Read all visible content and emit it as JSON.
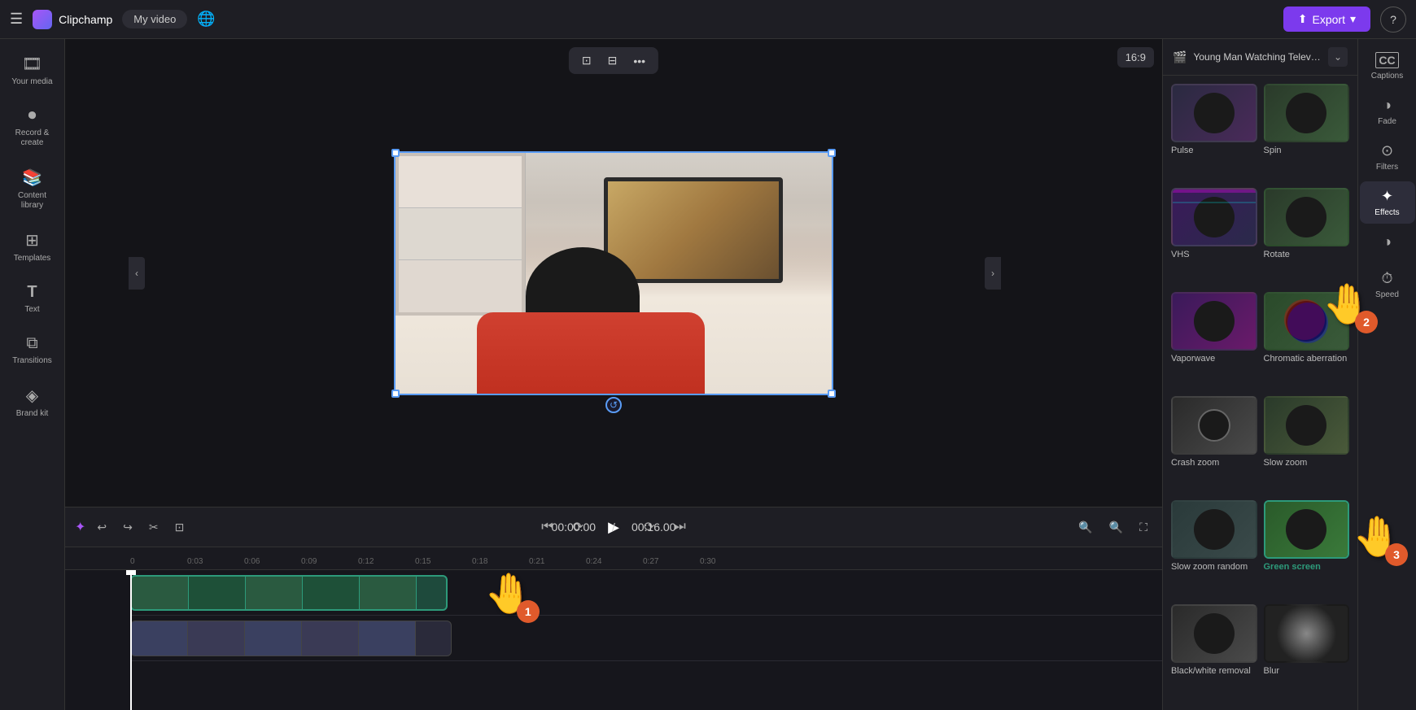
{
  "app": {
    "name": "Clipchamp",
    "video_title": "My video",
    "export_label": "Export",
    "help_label": "?"
  },
  "sidebar": {
    "items": [
      {
        "id": "your-media",
        "icon": "🎞",
        "label": "Your media"
      },
      {
        "id": "record-create",
        "icon": "⏺",
        "label": "Record & create"
      },
      {
        "id": "content-library",
        "icon": "📚",
        "label": "Content library"
      },
      {
        "id": "templates",
        "icon": "⊞",
        "label": "Templates"
      },
      {
        "id": "text",
        "icon": "T",
        "label": "Text"
      },
      {
        "id": "transitions",
        "icon": "⧉",
        "label": "Transitions"
      },
      {
        "id": "brand-kit",
        "icon": "◈",
        "label": "Brand kit"
      }
    ]
  },
  "preview": {
    "aspect_ratio": "16:9",
    "toolbar_items": [
      "crop",
      "fit",
      "more"
    ]
  },
  "timeline": {
    "current_time": "00:00.00",
    "total_time": "00:16.00",
    "ruler_marks": [
      "0",
      "0:03",
      "0:06",
      "0:09",
      "0:12",
      "0:15",
      "0:18",
      "0:21",
      "0:24",
      "0:27",
      "0:30"
    ]
  },
  "right_panel": {
    "video_title": "Young Man Watching Television...",
    "expand_icon": "⌄"
  },
  "effects_panel": {
    "items": [
      {
        "id": "pulse",
        "label": "Pulse",
        "thumb_class": "thumb-pulse"
      },
      {
        "id": "spin",
        "label": "Spin",
        "thumb_class": "thumb-spin"
      },
      {
        "id": "vhs",
        "label": "VHS",
        "thumb_class": "thumb-vhs"
      },
      {
        "id": "rotate",
        "label": "Rotate",
        "thumb_class": "thumb-rotate"
      },
      {
        "id": "vaporwave",
        "label": "Vaporwave",
        "thumb_class": "thumb-vaporwave"
      },
      {
        "id": "chromatic-aberration",
        "label": "Chromatic aberration",
        "thumb_class": "thumb-chromatic"
      },
      {
        "id": "crash-zoom",
        "label": "Crash zoom",
        "thumb_class": "thumb-crashzoom"
      },
      {
        "id": "slow-zoom",
        "label": "Slow zoom",
        "thumb_class": "thumb-slowzoom"
      },
      {
        "id": "slow-zoom-random",
        "label": "Slow zoom random",
        "thumb_class": "thumb-slowzoomrand"
      },
      {
        "id": "green-screen",
        "label": "Green screen",
        "thumb_class": "thumb-greenscreen",
        "selected": true
      },
      {
        "id": "bw-removal",
        "label": "Black/white removal",
        "thumb_class": "thumb-bwremoval"
      },
      {
        "id": "blur",
        "label": "Blur",
        "thumb_class": "thumb-blur"
      }
    ]
  },
  "effects_sidebar": {
    "items": [
      {
        "id": "captions",
        "icon": "CC",
        "label": "Captions"
      },
      {
        "id": "fade",
        "icon": "◑",
        "label": "Fade"
      },
      {
        "id": "filters",
        "icon": "⊙",
        "label": "Filters"
      },
      {
        "id": "effects",
        "icon": "✦",
        "label": "Effects",
        "active": true
      },
      {
        "id": "adjust",
        "icon": "◑",
        "label": ""
      },
      {
        "id": "speed",
        "icon": "⏱",
        "label": "Speed"
      }
    ]
  },
  "hands": [
    {
      "id": "hand1",
      "badge": "1",
      "style": "bottom: 8px; left: 570px;"
    },
    {
      "id": "hand2",
      "badge": "2",
      "style": "top: 350px; right: 52px;"
    },
    {
      "id": "hand3",
      "badge": "3",
      "style": "bottom: 180px; right: 14px;"
    }
  ]
}
